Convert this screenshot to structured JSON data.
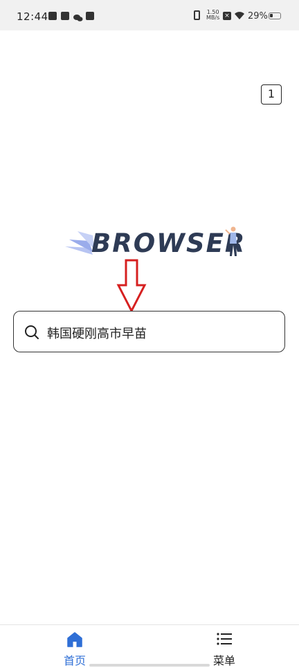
{
  "status_bar": {
    "time": "12:44",
    "net_speed_value": "1.50",
    "net_speed_unit": "MB/s",
    "battery_percent": "29%",
    "battery_level": 0.29
  },
  "tabs": {
    "count": "1"
  },
  "logo": {
    "text": "BROWSER"
  },
  "search": {
    "query": "韩国硬刚高市早苗"
  },
  "bottom_nav": {
    "home_label": "首页",
    "menu_label": "菜单",
    "active_color": "#2f6fd6"
  },
  "colors": {
    "arrow": "#d62020",
    "logo_text": "#2e3b55"
  }
}
